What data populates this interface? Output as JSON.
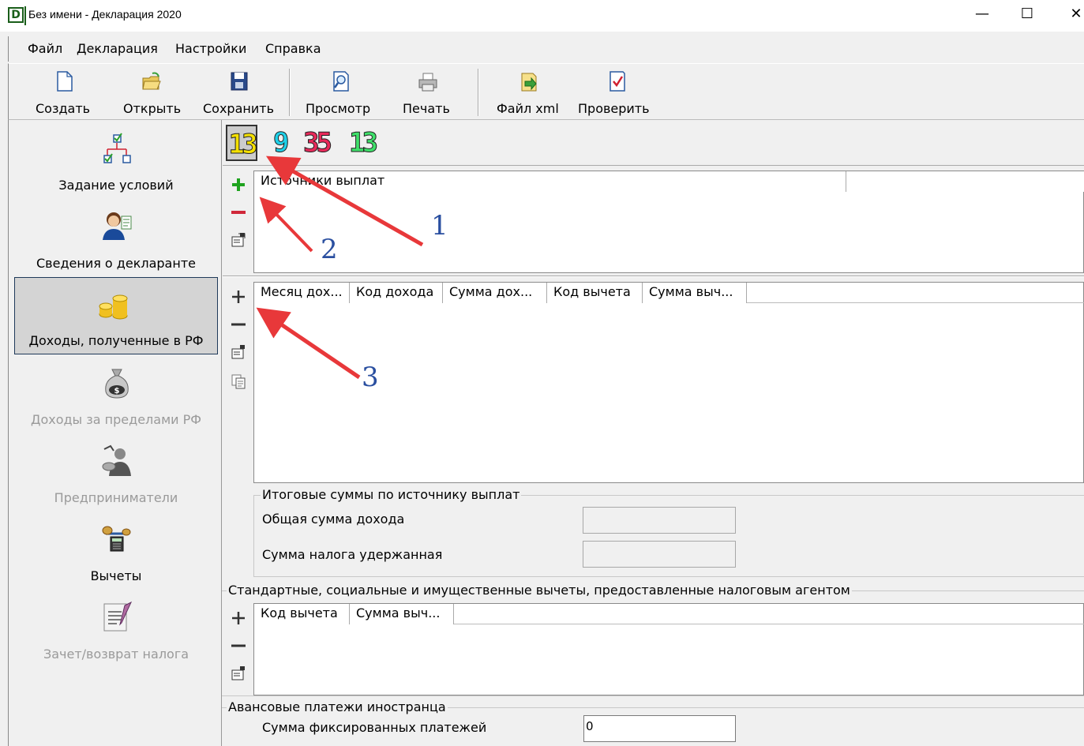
{
  "window": {
    "app_icon_letter": "D",
    "title": "Без имени - Декларация 2020",
    "minimize_glyph": "—",
    "maximize_glyph": "☐",
    "close_glyph": "✕"
  },
  "menu": [
    "Файл",
    "Декларация",
    "Настройки",
    "Справка"
  ],
  "toolbar": {
    "create": "Создать",
    "open": "Открыть",
    "save": "Сохранить",
    "preview": "Просмотр",
    "print": "Печать",
    "xml": "Файл xml",
    "check": "Проверить"
  },
  "sidebar": {
    "items": [
      {
        "label": "Задание условий",
        "icon": "conditions-tree-icon",
        "enabled": true
      },
      {
        "label": "Сведения о декларанте",
        "icon": "person-icon",
        "enabled": true
      },
      {
        "label": "Доходы, полученные в РФ",
        "icon": "coins-icon",
        "enabled": true,
        "active": true
      },
      {
        "label": "Доходы за пределами РФ",
        "icon": "money-bag-icon",
        "enabled": false
      },
      {
        "label": "Предприниматели",
        "icon": "entrepreneur-icon",
        "enabled": false
      },
      {
        "label": "Вычеты",
        "icon": "scales-icon",
        "enabled": true
      },
      {
        "label": "Зачет/возврат налога",
        "icon": "document-icon",
        "enabled": false
      }
    ]
  },
  "tax_rates": [
    {
      "value": "13",
      "color": "#f4e000",
      "selected": true
    },
    {
      "value": "9",
      "color": "#1fd0e8",
      "selected": false
    },
    {
      "value": "35",
      "color": "#e82a5a",
      "selected": false
    },
    {
      "value": "13",
      "color": "#3fe06a",
      "selected": false
    }
  ],
  "sources_table": {
    "columns": [
      "Источники выплат",
      ""
    ]
  },
  "income_table": {
    "columns": [
      "Месяц дох...",
      "Код дохода",
      "Сумма дох...",
      "Код вычета",
      "Сумма выч..."
    ]
  },
  "totals": {
    "title": "Итоговые суммы по источнику выплат",
    "total_income_label": "Общая сумма дохода",
    "total_income_value": "",
    "tax_withheld_label": "Сумма налога удержанная",
    "tax_withheld_value": ""
  },
  "deductions": {
    "title": "Стандартные, социальные и имущественные вычеты, предоставленные налоговым агентом",
    "columns": [
      "Код вычета",
      "Сумма выч..."
    ]
  },
  "advance": {
    "title": "Авансовые платежи иностранца",
    "fixed_payments_label": "Сумма фиксированных платежей",
    "fixed_payments_value": "0"
  },
  "annotations": [
    "1",
    "2",
    "3"
  ],
  "colors": {
    "arrow": "#e8383a",
    "annotation_text": "#2a4fa0",
    "add_green": "#1fa31f",
    "remove_red": "#d0283a"
  }
}
